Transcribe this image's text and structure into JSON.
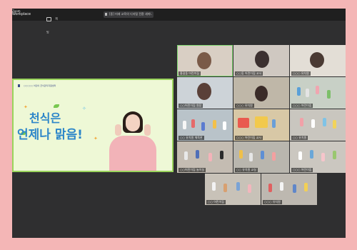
{
  "app": {
    "logo_line1": "Zoom",
    "logo_line2": "Workplace",
    "chat_label": "채팅",
    "meeting_tab_label": "[중] 미래 교육의 디지털 전환 세미나"
  },
  "share": {
    "org_text": "○○○○○ 어린이 급식관리지원센터",
    "title_line1": "천식은",
    "title_line2": "언제나 맑음!"
  },
  "participants": [
    {
      "name": "홍길동 어린이집"
    },
    {
      "name": "○○동 어린이집 교사"
    },
    {
      "name": "○○○ 유치원"
    },
    {
      "name": "○○어린이집 원장"
    },
    {
      "name": "○○○ 유치원"
    },
    {
      "name": "○○○ 어린이집"
    },
    {
      "name": "○○ 유치원 체육관"
    },
    {
      "name": "○○○ 어린이집 교사"
    },
    {
      "name": "○○ 유치원"
    },
    {
      "name": "○○어린이집 놀이실"
    },
    {
      "name": "○○ 유치원 교실"
    },
    {
      "name": "○○○ 어린이집"
    },
    {
      "name": "○○ 어린이집"
    },
    {
      "name": "○○○ 유치원"
    },
    {
      "name": "○○ 유치원"
    },
    {
      "name": "○○ 어린이집"
    },
    {
      "name": "○○ 유치원"
    },
    {
      "name": "○○○ 어린이집"
    }
  ],
  "colors": {
    "accent": "#7dd66e",
    "title_blue": "#2d86c9",
    "slide_bg": "#eef8d6",
    "outer_bg": "#f4b6b6"
  }
}
